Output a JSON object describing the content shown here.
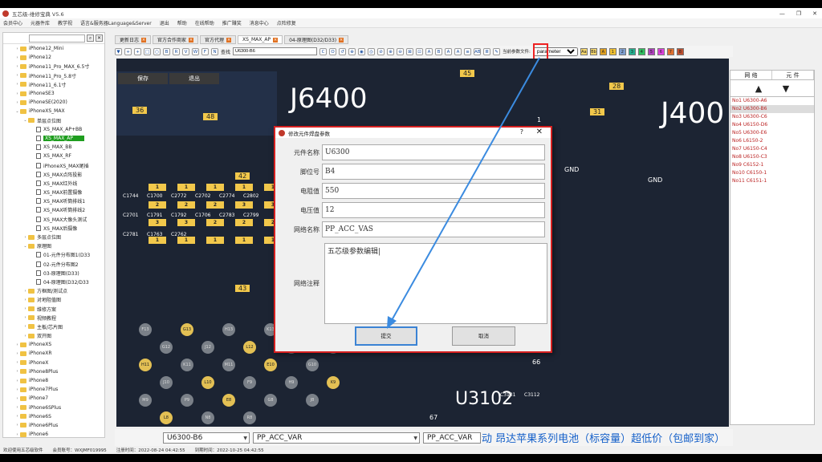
{
  "app": {
    "title": "五芯级-维修宝典 V5.6",
    "win_buttons": [
      "—",
      "❐",
      "✕"
    ]
  },
  "menu": [
    "会员中心",
    "元器件库",
    "教学视",
    "语言&服务器Language&Server",
    "退出",
    "帮助",
    "在线帮助",
    "推广赚奖",
    "消息中心",
    "点阵修复"
  ],
  "tree": {
    "search_placeholder": "",
    "items": [
      {
        "label": "iPhone12_Mini",
        "lvl": 1,
        "type": "folder",
        "tw": "›"
      },
      {
        "label": "iPhone12",
        "lvl": 1,
        "type": "folder",
        "tw": "›"
      },
      {
        "label": "iPhone11_Pro_MAX_6.5寸",
        "lvl": 1,
        "type": "folder",
        "tw": "›"
      },
      {
        "label": "iPhone11_Pro_5.8寸",
        "lvl": 1,
        "type": "folder",
        "tw": "›"
      },
      {
        "label": "iPhone11_6.1寸",
        "lvl": 1,
        "type": "folder",
        "tw": "›"
      },
      {
        "label": "iPhoneSE3",
        "lvl": 1,
        "type": "folder",
        "tw": "›"
      },
      {
        "label": "iPhoneSE(2020)",
        "lvl": 1,
        "type": "folder",
        "tw": "›"
      },
      {
        "label": "iPhoneXS_MAX",
        "lvl": 1,
        "type": "folder",
        "tw": "⌄"
      },
      {
        "label": "单层点位图",
        "lvl": 2,
        "type": "folder",
        "tw": "⌄"
      },
      {
        "label": "XS_MAX_AP+BB",
        "lvl": 3,
        "type": "doc",
        "tw": ""
      },
      {
        "label": "XS_MAX_AP",
        "lvl": 3,
        "type": "doc",
        "tw": "",
        "sel": true
      },
      {
        "label": "XS_MAX_BB",
        "lvl": 3,
        "type": "doc",
        "tw": ""
      },
      {
        "label": "XS_MAX_RF",
        "lvl": 3,
        "type": "doc",
        "tw": ""
      },
      {
        "label": "iPhoneXS_MAX尾插",
        "lvl": 3,
        "type": "doc",
        "tw": ""
      },
      {
        "label": "XS_MAX点阵投影",
        "lvl": 3,
        "type": "doc",
        "tw": ""
      },
      {
        "label": "XS_MAX红外线",
        "lvl": 3,
        "type": "doc",
        "tw": ""
      },
      {
        "label": "XS_MAX前置摄像",
        "lvl": 3,
        "type": "doc",
        "tw": ""
      },
      {
        "label": "XS_MAX听筒排线1",
        "lvl": 3,
        "type": "doc",
        "tw": ""
      },
      {
        "label": "XS_MAX听筒排线2",
        "lvl": 3,
        "type": "doc",
        "tw": ""
      },
      {
        "label": "XS_MAX大像头测试",
        "lvl": 3,
        "type": "doc",
        "tw": ""
      },
      {
        "label": "XS_MAX后摄像",
        "lvl": 3,
        "type": "doc",
        "tw": ""
      },
      {
        "label": "多层点位图",
        "lvl": 2,
        "type": "folder",
        "tw": "›"
      },
      {
        "label": "原理图",
        "lvl": 2,
        "type": "folder",
        "tw": "⌄"
      },
      {
        "label": "01-元件分布图1(D33",
        "lvl": 3,
        "type": "doc",
        "tw": ""
      },
      {
        "label": "02-元件分布图2",
        "lvl": 3,
        "type": "doc",
        "tw": ""
      },
      {
        "label": "03-原理图(D33)",
        "lvl": 3,
        "type": "doc",
        "tw": ""
      },
      {
        "label": "04-原理图(D32/D33",
        "lvl": 3,
        "type": "doc",
        "tw": ""
      },
      {
        "label": "方框图/测试点",
        "lvl": 2,
        "type": "folder",
        "tw": "›"
      },
      {
        "label": "对地阻值图",
        "lvl": 2,
        "type": "folder",
        "tw": "›"
      },
      {
        "label": "维修方案",
        "lvl": 2,
        "type": "folder",
        "tw": "›"
      },
      {
        "label": "视频教程",
        "lvl": 2,
        "type": "folder",
        "tw": "›"
      },
      {
        "label": "主板/芯片图",
        "lvl": 2,
        "type": "folder",
        "tw": "›"
      },
      {
        "label": "双开图",
        "lvl": 2,
        "type": "folder",
        "tw": "›"
      },
      {
        "label": "iPhoneXS",
        "lvl": 1,
        "type": "folder",
        "tw": "›"
      },
      {
        "label": "iPhoneXR",
        "lvl": 1,
        "type": "folder",
        "tw": "›"
      },
      {
        "label": "iPhoneX",
        "lvl": 1,
        "type": "folder",
        "tw": "›"
      },
      {
        "label": "iPhone8Plus",
        "lvl": 1,
        "type": "folder",
        "tw": "›"
      },
      {
        "label": "iPhone8",
        "lvl": 1,
        "type": "folder",
        "tw": "›"
      },
      {
        "label": "iPhone7Plus",
        "lvl": 1,
        "type": "folder",
        "tw": "›"
      },
      {
        "label": "iPhone7",
        "lvl": 1,
        "type": "folder",
        "tw": "›"
      },
      {
        "label": "iPhone6SPlus",
        "lvl": 1,
        "type": "folder",
        "tw": "›"
      },
      {
        "label": "iPhone6S",
        "lvl": 1,
        "type": "folder",
        "tw": "›"
      },
      {
        "label": "iPhone6Plus",
        "lvl": 1,
        "type": "folder",
        "tw": "›"
      },
      {
        "label": "iPhone6",
        "lvl": 1,
        "type": "folder",
        "tw": "›"
      }
    ]
  },
  "tabs": [
    {
      "label": "更新日志",
      "active": false
    },
    {
      "label": "官方合作商家",
      "active": false
    },
    {
      "label": "官方代理",
      "active": false
    },
    {
      "label": "XS_MAX_AP",
      "active": true
    },
    {
      "label": "04-原理图(D32/D33)",
      "active": false
    }
  ],
  "toolbar": {
    "search_label": "查找",
    "search_value": "U6300-B6",
    "param_label": "当前参数文件:",
    "param_value": "parameter",
    "icons_left": [
      "▼",
      "+",
      "+",
      "□",
      "○",
      "B",
      "R",
      "V",
      "W",
      "F",
      "N"
    ],
    "icons_mid": [
      "C",
      "O",
      "↺",
      "⊕",
      "◉",
      "◎",
      "⊘",
      "⊕",
      "⊖",
      "⊠",
      "⊡",
      "A",
      "B",
      "A",
      "A",
      "≡",
      "AB",
      "≣"
    ],
    "color_boxes": [
      {
        "t": "Aa",
        "c": "#f5d76e"
      },
      {
        "t": "Bb",
        "c": "#f5d76e"
      },
      {
        "t": "A",
        "c": "#e0a020"
      },
      {
        "t": "1",
        "c": "#f0c030"
      },
      {
        "t": "2",
        "c": "#7f9fd0"
      },
      {
        "t": "3",
        "c": "#25b090"
      },
      {
        "t": "4",
        "c": "#30c060"
      },
      {
        "t": "5",
        "c": "#b040c0"
      },
      {
        "t": "6",
        "c": "#e040e0"
      },
      {
        "t": "7",
        "c": "#e07030"
      },
      {
        "t": "8",
        "c": "#c05030"
      }
    ]
  },
  "board": {
    "chip1": "J6400",
    "chip2": "J400",
    "chip3": "U3102",
    "left_buttons": [
      "保存",
      "退出"
    ],
    "labels": [
      "45",
      "36",
      "48",
      "42",
      "43",
      "31",
      "28",
      "1",
      "66",
      "67",
      "GND",
      "GND"
    ],
    "pads": [
      "1",
      "1",
      "1",
      "1",
      "1",
      "1",
      "1",
      "2",
      "2",
      "2",
      "2",
      "3",
      "3",
      "3",
      "3",
      "3",
      "3",
      "3",
      "2",
      "2",
      "2",
      "1",
      "1",
      "1",
      "1",
      "1",
      "1",
      "1",
      "1",
      "1",
      "1"
    ],
    "components": [
      "C1744",
      "C1700",
      "C2772",
      "C2702",
      "C2774",
      "C2802",
      "C2701",
      "C1791",
      "C1792",
      "C1706",
      "C2783",
      "C2799",
      "C2781",
      "C1763",
      "C2762",
      "C3131",
      "C3112"
    ],
    "balls": [
      "F13",
      "G13",
      "H13",
      "K13",
      "E12",
      "G12",
      "J12",
      "L12",
      "N12",
      "F11",
      "H11",
      "K11",
      "M11",
      "E10",
      "G10",
      "J10",
      "L10",
      "F9",
      "H9",
      "K9",
      "M9",
      "P9",
      "E8",
      "G8",
      "J8",
      "L8",
      "N8",
      "R8"
    ]
  },
  "dialog": {
    "title": "修改元件焊盘参数",
    "help": "?",
    "close": "✕",
    "fields": [
      {
        "label": "元件名称",
        "value": "U6300"
      },
      {
        "label": "脚位号",
        "value": "B4"
      },
      {
        "label": "电阻值",
        "value": "550"
      },
      {
        "label": "电压值",
        "value": "12"
      },
      {
        "label": "网络名称",
        "value": "PP_ACC_VAS"
      }
    ],
    "note_label": "网络注释",
    "note_value": "五芯级参数编辑",
    "ok_label": "提交",
    "cancel_label": "取消"
  },
  "right": {
    "tab1": "网 络",
    "tab2": "元 件",
    "up": "▲",
    "down": "▼",
    "items": [
      {
        "label": "No1  U6300-A6",
        "sel": false
      },
      {
        "label": "No2  U6300-B6",
        "sel": true
      },
      {
        "label": "No3  U6300-C6",
        "sel": false
      },
      {
        "label": "No4  U6150-D6",
        "sel": false
      },
      {
        "label": "No5  U6300-E6",
        "sel": false
      },
      {
        "label": "No6  L6150-2",
        "sel": false
      },
      {
        "label": "No7  U6150-C4",
        "sel": false
      },
      {
        "label": "No8  U6150-C3",
        "sel": false
      },
      {
        "label": "No9  C6152-1",
        "sel": false
      },
      {
        "label": "No10  C6150-1",
        "sel": false
      },
      {
        "label": "No11  C6151-1",
        "sel": false
      }
    ]
  },
  "bottom": {
    "combo1": "U6300-B6",
    "combo2": "PP_ACC_VAR",
    "text3": "PP_ACC_VAR",
    "promo": "动  昂达苹果系列电池（标容量）超低价（包邮到家）"
  },
  "status": {
    "welcome": "欢迎使用五芯级软件",
    "account": "会员账号：WXJMF019995",
    "reg": "注册时间：2022-08-24 04:42:55",
    "exp": "到期时间：2022-10-25 04:42:55"
  },
  "colors": {
    "board": "#1c2433",
    "pad": "#f2c84b",
    "highlight": "#e22222",
    "arrow": "#3b8be0",
    "select": "#1f9e1f"
  }
}
